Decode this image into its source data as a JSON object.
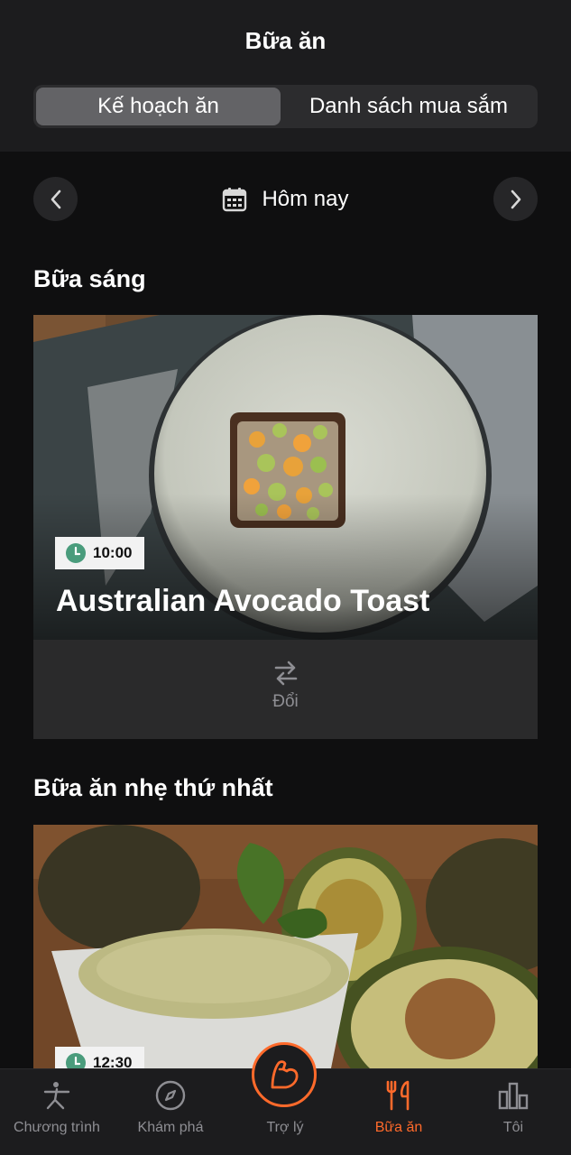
{
  "header": {
    "title": "Bữa ăn",
    "segments": [
      {
        "label": "Kế hoạch ăn",
        "active": true
      },
      {
        "label": "Danh sách mua sắm",
        "active": false
      }
    ]
  },
  "date_nav": {
    "label": "Hôm nay",
    "prev_icon": "chevron-left-icon",
    "next_icon": "chevron-right-icon",
    "calendar_icon": "calendar-icon"
  },
  "meals": [
    {
      "section": "Bữa sáng",
      "time": "10:00",
      "name": "Australian Avocado Toast",
      "swap_label": "Đổi"
    },
    {
      "section": "Bữa ăn nhẹ thứ nhất",
      "time": "12:30"
    }
  ],
  "tabbar": {
    "tabs": [
      {
        "label": "Chương trình",
        "icon": "stretch-person-icon"
      },
      {
        "label": "Khám phá",
        "icon": "compass-icon"
      },
      {
        "label": "Trợ lý",
        "icon": "muscle-arm-icon"
      },
      {
        "label": "Bữa ăn",
        "icon": "fork-knife-icon",
        "active": true
      },
      {
        "label": "Tôi",
        "icon": "bar-chart-icon"
      }
    ]
  },
  "colors": {
    "accent": "#ff6a2b",
    "clock": "#4a9c7c",
    "background": "#0f0f10"
  }
}
